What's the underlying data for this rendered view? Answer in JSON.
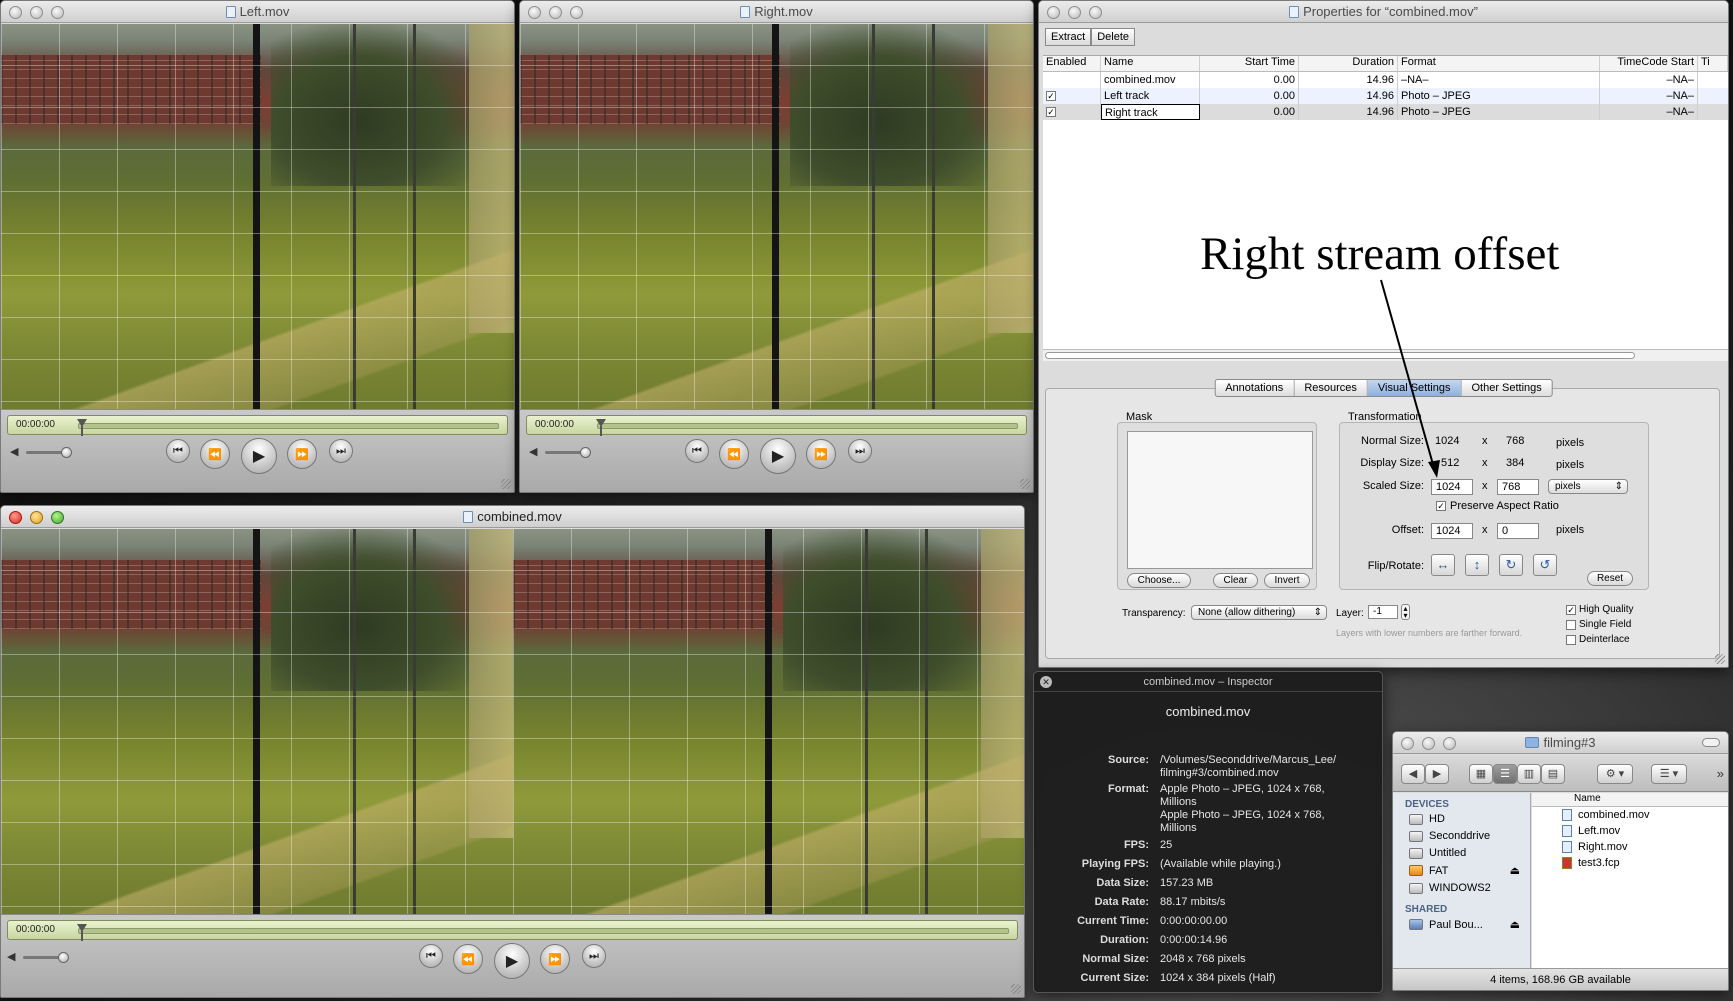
{
  "left_window": {
    "title": "Left.mov",
    "timecode": "00:00:00"
  },
  "right_window": {
    "title": "Right.mov",
    "timecode": "00:00:00"
  },
  "combined_window": {
    "title": "combined.mov",
    "timecode": "00:00:00"
  },
  "transport": {
    "to_start": "⏮",
    "rewind": "⏪",
    "play": "▶",
    "fast_forward": "⏩",
    "to_end": "⏭",
    "volume": "◀"
  },
  "properties": {
    "title": "Properties for “combined.mov”",
    "toolbar": {
      "extract": "Extract",
      "delete": "Delete"
    },
    "columns": [
      "Enabled",
      "Name",
      "Start Time",
      "Duration",
      "Format",
      "TimeCode Start",
      "Ti"
    ],
    "rows": [
      {
        "enabled": "",
        "name": "combined.mov",
        "start": "0.00",
        "duration": "14.96",
        "format": "–NA–",
        "tc": "–NA–"
      },
      {
        "enabled": "✓",
        "name": "Left track",
        "start": "0.00",
        "duration": "14.96",
        "format": "Photo – JPEG",
        "tc": "–NA–"
      },
      {
        "enabled": "✓",
        "name": "Right track",
        "start": "0.00",
        "duration": "14.96",
        "format": "Photo – JPEG",
        "tc": "–NA–"
      }
    ],
    "tabs": [
      "Annotations",
      "Resources",
      "Visual Settings",
      "Other Settings"
    ],
    "active_tab": "Visual Settings",
    "mask": {
      "label": "Mask",
      "choose": "Choose...",
      "clear": "Clear",
      "invert": "Invert"
    },
    "transformation": {
      "label": "Transformation",
      "normal_size_label": "Normal Size:",
      "normal_w": "1024",
      "normal_h": "768",
      "display_size_label": "Display Size:",
      "display_w": "512",
      "display_h": "384",
      "scaled_size_label": "Scaled Size:",
      "scaled_w": "1024",
      "scaled_h": "768",
      "unit": "pixels",
      "x": "x",
      "preserve_aspect": "Preserve Aspect Ratio",
      "offset_label": "Offset:",
      "offset_x": "1024",
      "offset_y": "0",
      "flip_rotate_label": "Flip/Rotate:",
      "reset": "Reset"
    },
    "transparency_label": "Transparency:",
    "transparency_value": "None (allow dithering)",
    "layer_label": "Layer:",
    "layer_value": "-1",
    "layer_hint": "Layers with lower numbers are farther forward.",
    "high_quality": "High Quality",
    "single_field": "Single Field",
    "deinterlace": "Deinterlace"
  },
  "annotation": "Right stream offset",
  "inspector": {
    "title": "combined.mov – Inspector",
    "name": "combined.mov",
    "rows": [
      {
        "k": "Source:",
        "v": "/Volumes/Seconddrive/Marcus_Lee/ filming#3/combined.mov"
      },
      {
        "k": "Format:",
        "v": "Apple Photo – JPEG, 1024 x 768, Millions"
      },
      {
        "k": "",
        "v": "Apple Photo – JPEG, 1024 x 768, Millions"
      },
      {
        "k": "FPS:",
        "v": "25"
      },
      {
        "k": "Playing FPS:",
        "v": "(Available while playing.)"
      },
      {
        "k": "Data Size:",
        "v": "157.23 MB"
      },
      {
        "k": "Data Rate:",
        "v": "88.17 mbits/s"
      },
      {
        "k": "Current Time:",
        "v": "0:00:00:00.00"
      },
      {
        "k": "Duration:",
        "v": "0:00:00:14.96"
      },
      {
        "k": "Normal Size:",
        "v": "2048 x 768 pixels"
      },
      {
        "k": "Current Size:",
        "v": "1024 x 384 pixels (Half)"
      }
    ]
  },
  "finder": {
    "title": "filming#3",
    "devices_label": "DEVICES",
    "devices": [
      "HD",
      "Seconddrive",
      "Untitled",
      "FAT",
      "WINDOWS2"
    ],
    "shared_label": "SHARED",
    "shared": [
      "Paul Bou..."
    ],
    "column_name": "Name",
    "files": [
      "combined.mov",
      "Left.mov",
      "Right.mov",
      "test3.fcp"
    ],
    "status": "4 items, 168.96 GB available"
  }
}
